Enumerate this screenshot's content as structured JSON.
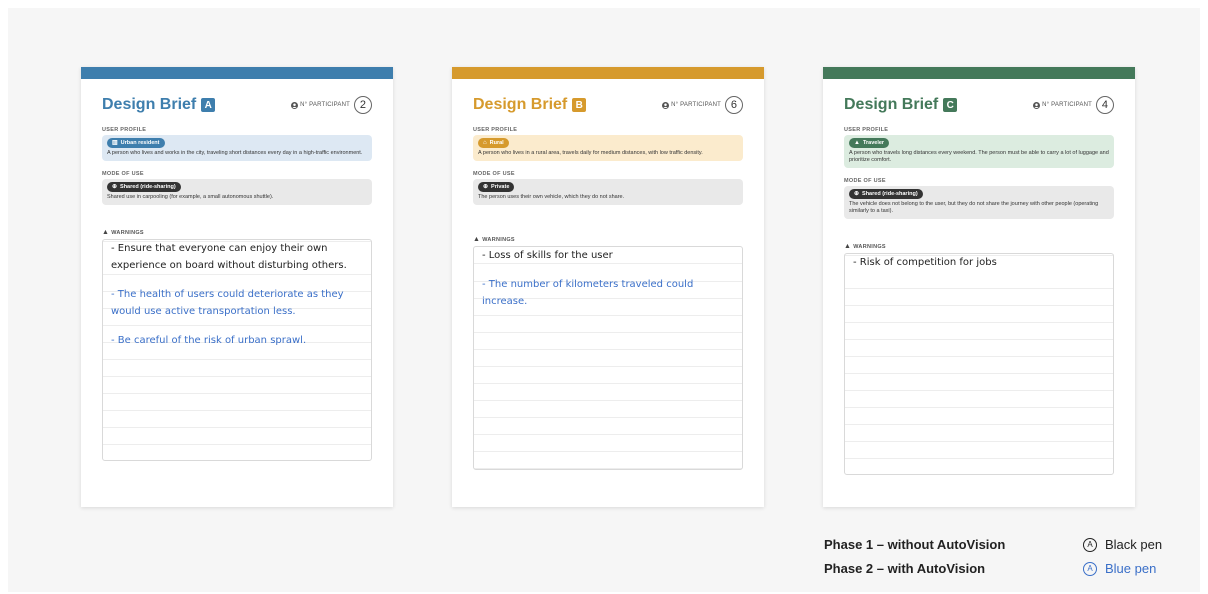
{
  "colors": {
    "blue": "#3e7ead",
    "orange": "#d69a2d",
    "green": "#44795a",
    "blue_pen": "#3a6fc8",
    "black_pen": "#222222"
  },
  "participant_label": "N° PARTICIPANT",
  "user_profile_label": "USER PROFILE",
  "mode_label": "MODE OF USE",
  "warnings_label": "WARNINGS",
  "cards": [
    {
      "title": "Design Brief",
      "letter": "A",
      "participant": "2",
      "profile_tag": "Urban resident",
      "profile_icon": "building-icon",
      "profile_text": "A person who lives and works in the city, traveling short distances every day in a high-traffic environment.",
      "mode_tag": "Shared (ride-sharing)",
      "mode_text": "Shared use in carpooling (for example, a small autonomous shuttle).",
      "warnings": [
        {
          "text": "- Ensure that everyone can enjoy their own experience on board without disturbing others.",
          "pen": "black"
        },
        {
          "text": "- The health of users could deteriorate as they would use active transportation less.",
          "pen": "blue"
        },
        {
          "text": "- Be careful of the risk of urban sprawl.",
          "pen": "blue"
        }
      ]
    },
    {
      "title": "Design Brief",
      "letter": "B",
      "participant": "6",
      "profile_tag": "Rural",
      "profile_icon": "house-icon",
      "profile_text": "A person who lives in a rural area, travels daily for medium distances, with low traffic density.",
      "mode_tag": "Private",
      "mode_text": "The person uses their own vehicle, which they do not share.",
      "warnings": [
        {
          "text": "- Loss of skills for the user",
          "pen": "black"
        },
        {
          "text": "- The number of kilometers traveled could increase.",
          "pen": "blue"
        }
      ]
    },
    {
      "title": "Design Brief",
      "letter": "C",
      "participant": "4",
      "profile_tag": "Traveler",
      "profile_icon": "mountain-icon",
      "profile_text": "A person who travels long distances every weekend. The person must be able to carry a lot of luggage and prioritize comfort.",
      "mode_tag": "Shared (ride-sharing)",
      "mode_text": "The vehicle does not belong to the user, but they do not share the journey with other people (operating similarly to a taxi).",
      "warnings": [
        {
          "text": "- Risk of competition for jobs",
          "pen": "black"
        }
      ]
    }
  ],
  "legend": {
    "phase1": "Phase 1 – without AutoVision",
    "phase2": "Phase 2 – with AutoVision",
    "pen1": "Black pen",
    "pen2": "Blue pen"
  }
}
